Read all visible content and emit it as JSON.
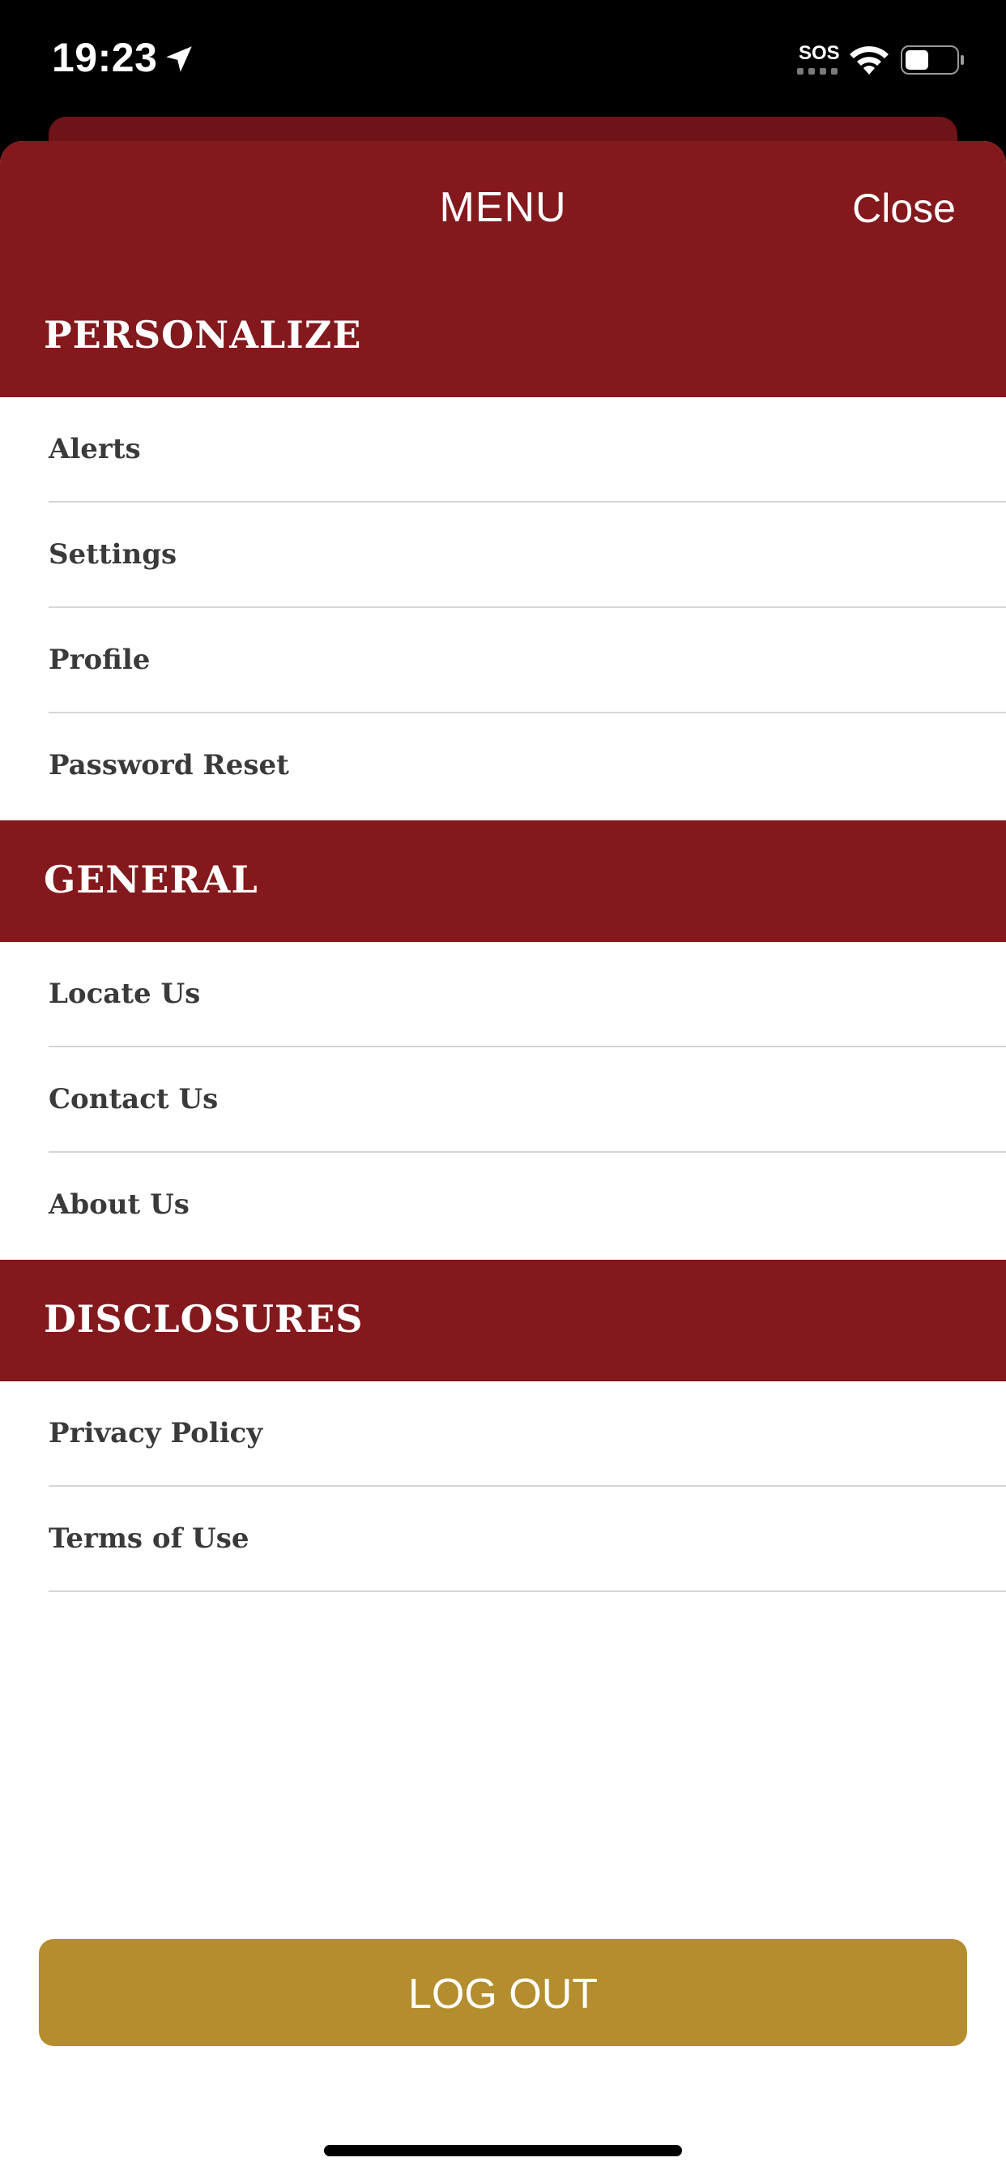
{
  "status_bar": {
    "time": "19:23",
    "sos": "SOS"
  },
  "menu": {
    "title": "MENU",
    "close_label": "Close"
  },
  "sections": [
    {
      "title": "PERSONALIZE",
      "items": [
        "Alerts",
        "Settings",
        "Profile",
        "Password Reset"
      ]
    },
    {
      "title": "GENERAL",
      "items": [
        "Locate Us",
        "Contact Us",
        "About Us"
      ]
    },
    {
      "title": "DISCLOSURES",
      "items": [
        "Privacy Policy",
        "Terms of Use"
      ]
    }
  ],
  "logout_label": "LOG OUT",
  "colors": {
    "header_red": "#83191d",
    "logout_gold": "#b48d2e",
    "item_text": "#3a3a3a",
    "divider": "#d6d6d6"
  },
  "icons": {
    "location": "location-arrow-icon",
    "wifi": "wifi-icon",
    "battery": "battery-icon"
  }
}
